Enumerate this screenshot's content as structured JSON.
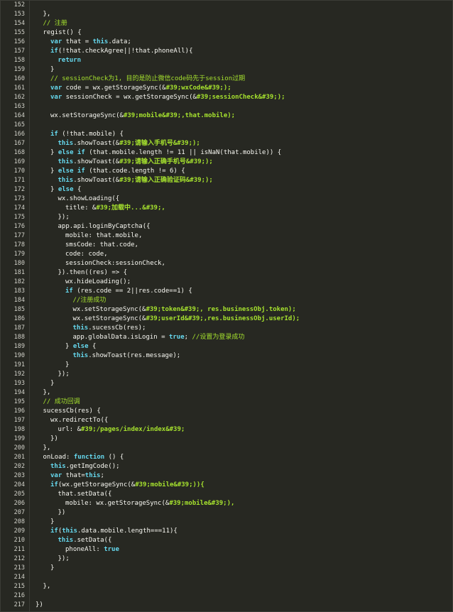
{
  "lines": [
    {
      "n": "152",
      "i": 0,
      "t": [
        {
          "c": "pl",
          "v": ""
        }
      ]
    },
    {
      "n": "153",
      "i": 1,
      "t": [
        {
          "c": "pl",
          "v": "},"
        }
      ]
    },
    {
      "n": "154",
      "i": 1,
      "t": [
        {
          "c": "cm",
          "v": "// 注册"
        }
      ]
    },
    {
      "n": "155",
      "i": 1,
      "t": [
        {
          "c": "pl",
          "v": "regist() {"
        }
      ]
    },
    {
      "n": "156",
      "i": 2,
      "t": [
        {
          "c": "kw",
          "v": "var"
        },
        {
          "c": "pl",
          "v": " that = "
        },
        {
          "c": "kw",
          "v": "this"
        },
        {
          "c": "pl",
          "v": ".data;"
        }
      ]
    },
    {
      "n": "157",
      "i": 2,
      "t": [
        {
          "c": "kw",
          "v": "if"
        },
        {
          "c": "pl",
          "v": "(!that.checkAgree||!that.phoneAll){"
        }
      ]
    },
    {
      "n": "158",
      "i": 3,
      "t": [
        {
          "c": "kw",
          "v": "return"
        }
      ]
    },
    {
      "n": "159",
      "i": 2,
      "t": [
        {
          "c": "pl",
          "v": "}"
        }
      ]
    },
    {
      "n": "160",
      "i": 2,
      "t": [
        {
          "c": "cm",
          "v": "// sessionCheck为1, 目的是防止微信code码先于session过期"
        }
      ]
    },
    {
      "n": "161",
      "i": 2,
      "t": [
        {
          "c": "kw",
          "v": "var"
        },
        {
          "c": "pl",
          "v": " code = wx.getStorageSync(&"
        },
        {
          "c": "ac",
          "v": "#39;wxCode&#39;);"
        }
      ]
    },
    {
      "n": "162",
      "i": 2,
      "t": [
        {
          "c": "kw",
          "v": "var"
        },
        {
          "c": "pl",
          "v": " sessionCheck = wx.getStorageSync(&"
        },
        {
          "c": "ac",
          "v": "#39;sessionCheck&#39;);"
        }
      ]
    },
    {
      "n": "163",
      "i": 0,
      "t": [
        {
          "c": "pl",
          "v": ""
        }
      ]
    },
    {
      "n": "164",
      "i": 2,
      "t": [
        {
          "c": "pl",
          "v": "wx.setStorageSync(&"
        },
        {
          "c": "ac",
          "v": "#39;mobile&#39;,that.mobile);"
        }
      ]
    },
    {
      "n": "165",
      "i": 0,
      "t": [
        {
          "c": "pl",
          "v": ""
        }
      ]
    },
    {
      "n": "166",
      "i": 2,
      "t": [
        {
          "c": "kw",
          "v": "if"
        },
        {
          "c": "pl",
          "v": " (!that.mobile) {"
        }
      ]
    },
    {
      "n": "167",
      "i": 3,
      "t": [
        {
          "c": "kw",
          "v": "this"
        },
        {
          "c": "pl",
          "v": ".showToast(&"
        },
        {
          "c": "ac",
          "v": "#39;请输入手机号&#39;);"
        }
      ]
    },
    {
      "n": "168",
      "i": 2,
      "t": [
        {
          "c": "pl",
          "v": "} "
        },
        {
          "c": "kw",
          "v": "else if"
        },
        {
          "c": "pl",
          "v": " (that.mobile.length != 11 || isNaN(that.mobile)) {"
        }
      ]
    },
    {
      "n": "169",
      "i": 3,
      "t": [
        {
          "c": "kw",
          "v": "this"
        },
        {
          "c": "pl",
          "v": ".showToast(&"
        },
        {
          "c": "ac",
          "v": "#39;请输入正确手机号&#39;);"
        }
      ]
    },
    {
      "n": "170",
      "i": 2,
      "t": [
        {
          "c": "pl",
          "v": "} "
        },
        {
          "c": "kw",
          "v": "else if"
        },
        {
          "c": "pl",
          "v": " (that.code.length != 6) {"
        }
      ]
    },
    {
      "n": "171",
      "i": 3,
      "t": [
        {
          "c": "kw",
          "v": "this"
        },
        {
          "c": "pl",
          "v": ".showToast(&"
        },
        {
          "c": "ac",
          "v": "#39;请输入正确验证码&#39;);"
        }
      ]
    },
    {
      "n": "172",
      "i": 2,
      "t": [
        {
          "c": "pl",
          "v": "} "
        },
        {
          "c": "kw",
          "v": "else"
        },
        {
          "c": "pl",
          "v": " {"
        }
      ]
    },
    {
      "n": "173",
      "i": 3,
      "t": [
        {
          "c": "pl",
          "v": "wx.showLoading({"
        }
      ]
    },
    {
      "n": "174",
      "i": 4,
      "t": [
        {
          "c": "pl",
          "v": "title: &"
        },
        {
          "c": "ac",
          "v": "#39;加载中...&#39;,"
        }
      ]
    },
    {
      "n": "175",
      "i": 3,
      "t": [
        {
          "c": "pl",
          "v": "});"
        }
      ]
    },
    {
      "n": "176",
      "i": 3,
      "t": [
        {
          "c": "pl",
          "v": "app.api.loginByCaptcha({"
        }
      ]
    },
    {
      "n": "177",
      "i": 4,
      "t": [
        {
          "c": "pl",
          "v": "mobile: that.mobile,"
        }
      ]
    },
    {
      "n": "178",
      "i": 4,
      "t": [
        {
          "c": "pl",
          "v": "smsCode: that.code,"
        }
      ]
    },
    {
      "n": "179",
      "i": 4,
      "t": [
        {
          "c": "pl",
          "v": "code: code,"
        }
      ]
    },
    {
      "n": "180",
      "i": 4,
      "t": [
        {
          "c": "pl",
          "v": "sessionCheck:sessionCheck,"
        }
      ]
    },
    {
      "n": "181",
      "i": 3,
      "t": [
        {
          "c": "pl",
          "v": "}).then((res) => {"
        }
      ]
    },
    {
      "n": "182",
      "i": 4,
      "t": [
        {
          "c": "pl",
          "v": "wx.hideLoading();"
        }
      ]
    },
    {
      "n": "183",
      "i": 4,
      "t": [
        {
          "c": "kw",
          "v": "if"
        },
        {
          "c": "pl",
          "v": " (res.code == 2||res.code==1) {"
        }
      ]
    },
    {
      "n": "184",
      "i": 5,
      "t": [
        {
          "c": "cm",
          "v": "//注册成功"
        }
      ]
    },
    {
      "n": "185",
      "i": 5,
      "t": [
        {
          "c": "pl",
          "v": "wx.setStorageSync(&"
        },
        {
          "c": "ac",
          "v": "#39;token&#39;, res.businessObj.token);"
        }
      ]
    },
    {
      "n": "186",
      "i": 5,
      "t": [
        {
          "c": "pl",
          "v": "wx.setStorageSync(&"
        },
        {
          "c": "ac",
          "v": "#39;userId&#39;,res.businessObj.userId);"
        }
      ]
    },
    {
      "n": "187",
      "i": 5,
      "t": [
        {
          "c": "kw",
          "v": "this"
        },
        {
          "c": "pl",
          "v": ".sucessCb(res);"
        }
      ]
    },
    {
      "n": "188",
      "i": 5,
      "t": [
        {
          "c": "pl",
          "v": "app.globalData.isLogin = "
        },
        {
          "c": "kw",
          "v": "true"
        },
        {
          "c": "pl",
          "v": "; "
        },
        {
          "c": "cm",
          "v": "//设置为登录成功"
        }
      ]
    },
    {
      "n": "189",
      "i": 4,
      "t": [
        {
          "c": "pl",
          "v": "} "
        },
        {
          "c": "kw",
          "v": "else"
        },
        {
          "c": "pl",
          "v": " {"
        }
      ]
    },
    {
      "n": "190",
      "i": 5,
      "t": [
        {
          "c": "kw",
          "v": "this"
        },
        {
          "c": "pl",
          "v": ".showToast(res.message);"
        }
      ]
    },
    {
      "n": "191",
      "i": 4,
      "t": [
        {
          "c": "pl",
          "v": "}"
        }
      ]
    },
    {
      "n": "192",
      "i": 3,
      "t": [
        {
          "c": "pl",
          "v": "});"
        }
      ]
    },
    {
      "n": "193",
      "i": 2,
      "t": [
        {
          "c": "pl",
          "v": "}"
        }
      ]
    },
    {
      "n": "194",
      "i": 1,
      "t": [
        {
          "c": "pl",
          "v": "},"
        }
      ]
    },
    {
      "n": "195",
      "i": 1,
      "t": [
        {
          "c": "cm",
          "v": "// 成功回调"
        }
      ]
    },
    {
      "n": "196",
      "i": 1,
      "t": [
        {
          "c": "pl",
          "v": "sucessCb(res) {"
        }
      ]
    },
    {
      "n": "197",
      "i": 2,
      "t": [
        {
          "c": "pl",
          "v": "wx.redirectTo({"
        }
      ]
    },
    {
      "n": "198",
      "i": 3,
      "t": [
        {
          "c": "pl",
          "v": "url: &"
        },
        {
          "c": "ac",
          "v": "#39;/pages/index/index&#39;"
        }
      ]
    },
    {
      "n": "199",
      "i": 2,
      "t": [
        {
          "c": "pl",
          "v": "})"
        }
      ]
    },
    {
      "n": "200",
      "i": 1,
      "t": [
        {
          "c": "pl",
          "v": "},"
        }
      ]
    },
    {
      "n": "201",
      "i": 1,
      "t": [
        {
          "c": "pl",
          "v": "onLoad: "
        },
        {
          "c": "kw",
          "v": "function"
        },
        {
          "c": "pl",
          "v": " () {"
        }
      ]
    },
    {
      "n": "202",
      "i": 2,
      "t": [
        {
          "c": "kw",
          "v": "this"
        },
        {
          "c": "pl",
          "v": ".getImgCode();"
        }
      ]
    },
    {
      "n": "203",
      "i": 2,
      "t": [
        {
          "c": "kw",
          "v": "var"
        },
        {
          "c": "pl",
          "v": " that="
        },
        {
          "c": "kw",
          "v": "this"
        },
        {
          "c": "pl",
          "v": ";"
        }
      ]
    },
    {
      "n": "204",
      "i": 2,
      "t": [
        {
          "c": "kw",
          "v": "if"
        },
        {
          "c": "pl",
          "v": "(wx.getStorageSync(&"
        },
        {
          "c": "ac",
          "v": "#39;mobile&#39;)){"
        }
      ]
    },
    {
      "n": "205",
      "i": 3,
      "t": [
        {
          "c": "pl",
          "v": "that.setData({"
        }
      ]
    },
    {
      "n": "206",
      "i": 4,
      "t": [
        {
          "c": "pl",
          "v": "mobile: wx.getStorageSync(&"
        },
        {
          "c": "ac",
          "v": "#39;mobile&#39;),"
        }
      ]
    },
    {
      "n": "207",
      "i": 3,
      "t": [
        {
          "c": "pl",
          "v": "})"
        }
      ]
    },
    {
      "n": "208",
      "i": 2,
      "t": [
        {
          "c": "pl",
          "v": "}"
        }
      ]
    },
    {
      "n": "209",
      "i": 2,
      "t": [
        {
          "c": "kw",
          "v": "if"
        },
        {
          "c": "pl",
          "v": "("
        },
        {
          "c": "kw",
          "v": "this"
        },
        {
          "c": "pl",
          "v": ".data.mobile.length===11){"
        }
      ]
    },
    {
      "n": "210",
      "i": 3,
      "t": [
        {
          "c": "kw",
          "v": "this"
        },
        {
          "c": "pl",
          "v": ".setData({"
        }
      ]
    },
    {
      "n": "211",
      "i": 4,
      "t": [
        {
          "c": "pl",
          "v": "phoneAll: "
        },
        {
          "c": "kw",
          "v": "true"
        }
      ]
    },
    {
      "n": "212",
      "i": 3,
      "t": [
        {
          "c": "pl",
          "v": "});"
        }
      ]
    },
    {
      "n": "213",
      "i": 2,
      "t": [
        {
          "c": "pl",
          "v": "}"
        }
      ]
    },
    {
      "n": "214",
      "i": 0,
      "t": [
        {
          "c": "pl",
          "v": ""
        }
      ]
    },
    {
      "n": "215",
      "i": 1,
      "t": [
        {
          "c": "pl",
          "v": "},"
        }
      ]
    },
    {
      "n": "216",
      "i": 0,
      "t": [
        {
          "c": "pl",
          "v": ""
        }
      ]
    },
    {
      "n": "217",
      "i": 0,
      "t": [
        {
          "c": "pl",
          "v": "})"
        }
      ]
    }
  ]
}
